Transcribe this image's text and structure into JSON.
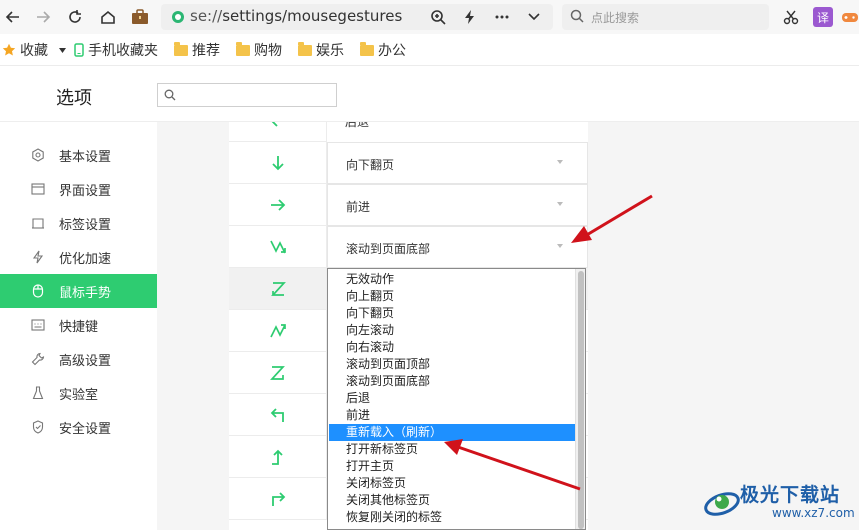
{
  "toolbar": {
    "url_scheme": "se://",
    "url_path": "settings/mousegestures",
    "search_placeholder": "点此搜索",
    "ext_translate": "译"
  },
  "bookmarks": {
    "favorites_label": "收藏",
    "items": [
      {
        "label": "手机收藏夹",
        "icon": "phone-icon"
      },
      {
        "label": "推荐",
        "icon": "folder-icon"
      },
      {
        "label": "购物",
        "icon": "folder-icon"
      },
      {
        "label": "娱乐",
        "icon": "folder-icon"
      },
      {
        "label": "办公",
        "icon": "folder-icon"
      }
    ]
  },
  "header": {
    "title": "选项",
    "search_placeholder": ""
  },
  "sidebar": {
    "items": [
      {
        "label": "基本设置",
        "icon": "gear-hex-icon"
      },
      {
        "label": "界面设置",
        "icon": "window-icon"
      },
      {
        "label": "标签设置",
        "icon": "tab-icon"
      },
      {
        "label": "优化加速",
        "icon": "lightning-icon"
      },
      {
        "label": "鼠标手势",
        "icon": "mouse-icon"
      },
      {
        "label": "快捷键",
        "icon": "keyboard-icon"
      },
      {
        "label": "高级设置",
        "icon": "wrench-icon"
      },
      {
        "label": "实验室",
        "icon": "flask-icon"
      },
      {
        "label": "安全设置",
        "icon": "shield-icon"
      }
    ],
    "active_index": 4
  },
  "gestures": {
    "rows": [
      {
        "action": "后退",
        "gesture": "left"
      },
      {
        "action": "向下翻页",
        "gesture": "down"
      },
      {
        "action": "前进",
        "gesture": "right"
      },
      {
        "action": "滚动到页面底部",
        "gesture": "down-zigzag"
      }
    ]
  },
  "dropdown": {
    "options": [
      "无效动作",
      "向上翻页",
      "向下翻页",
      "向左滚动",
      "向右滚动",
      "滚动到页面顶部",
      "滚动到页面底部",
      "后退",
      "前进",
      "重新载入（刷新）",
      "打开新标签页",
      "打开主页",
      "关闭标签页",
      "关闭其他标签页",
      "恢复刚关闭的标签"
    ],
    "selected_index": 9
  },
  "watermark": {
    "title": "极光下载站",
    "url": "www.xz7.com"
  },
  "colors": {
    "accent": "#2ecc71",
    "gesture_icon": "#2ecc71",
    "annotation_arrow": "#d0121b",
    "dropdown_selected": "#1e90ff"
  }
}
